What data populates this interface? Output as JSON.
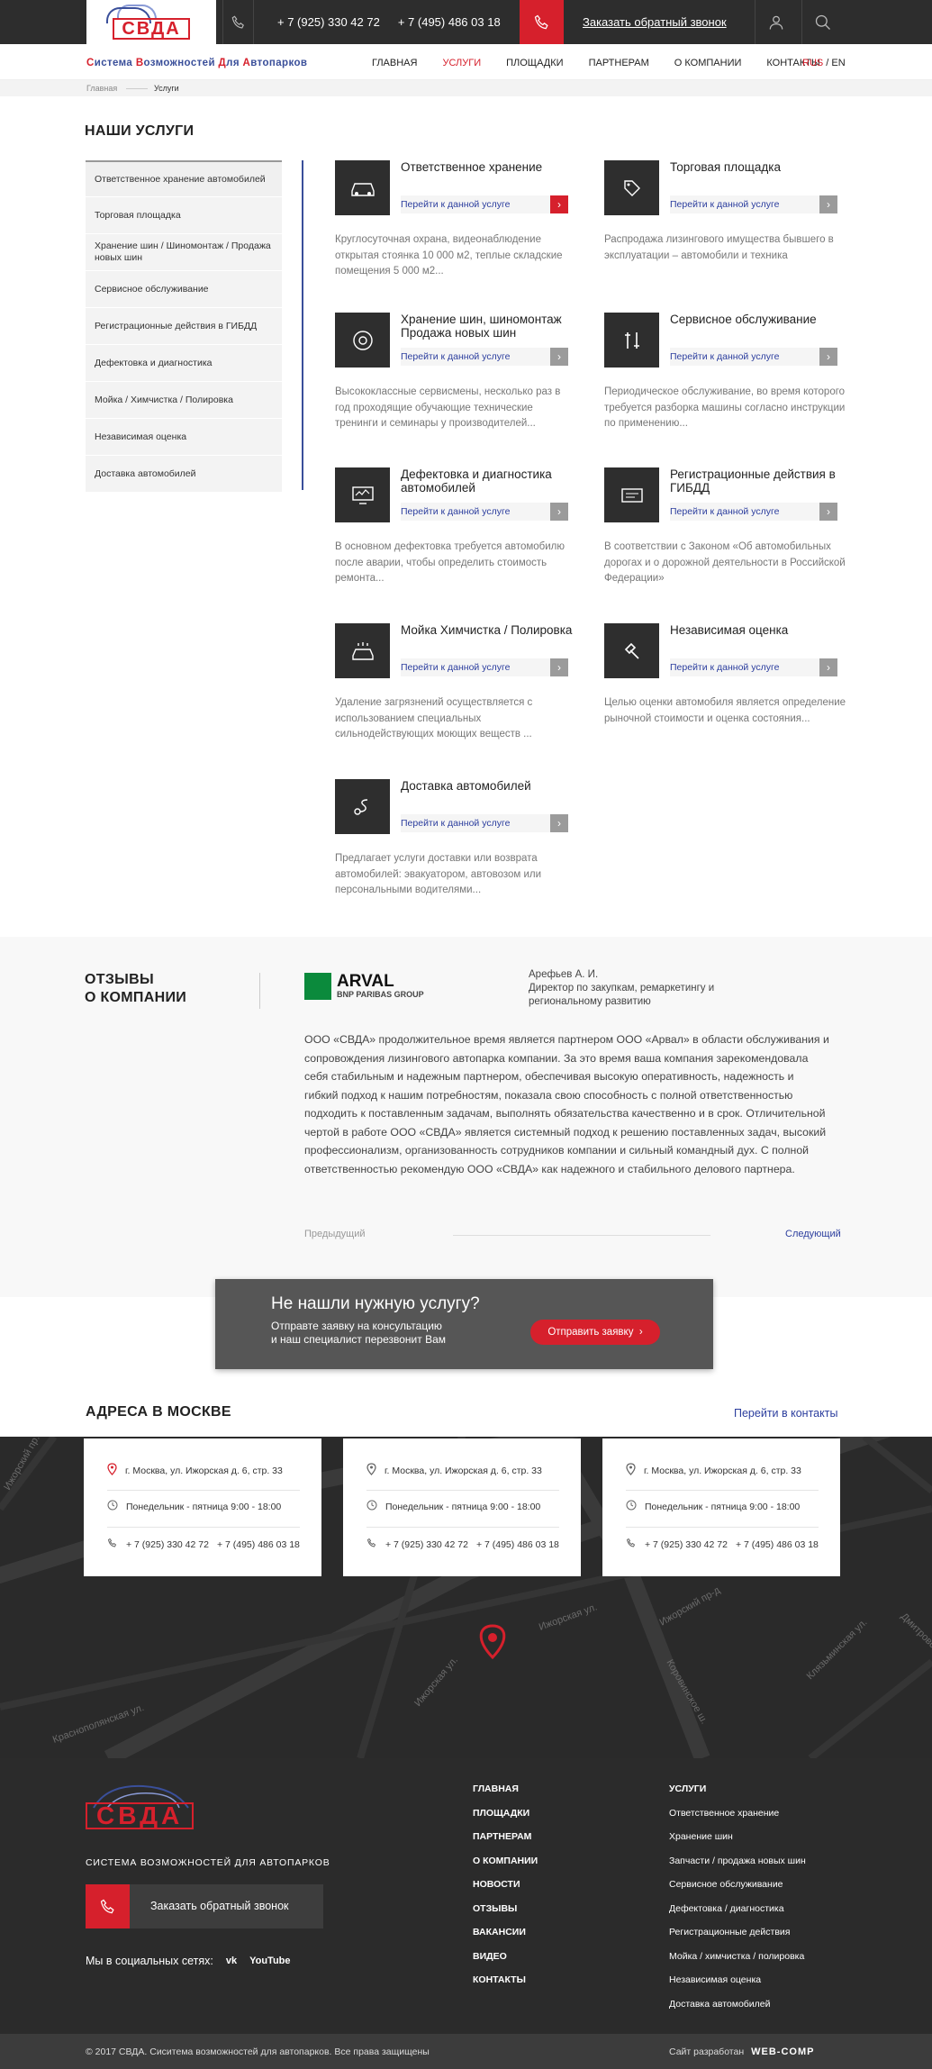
{
  "header": {
    "logo_text": "СВДА",
    "phone1": "+ 7 (925) 330 42 72",
    "phone2": "+ 7 (495) 486 03 18",
    "callback": "Заказать обратный звонок"
  },
  "nav": {
    "tagline_parts": [
      "С",
      "истема ",
      "В",
      "озможностей ",
      "Д",
      "ля ",
      "А",
      "втопарков"
    ],
    "items": [
      "ГЛАВНАЯ",
      "УСЛУГИ",
      "ПЛОЩАДКИ",
      "ПАРТНЕРАМ",
      "О КОМПАНИИ",
      "КОНТАКТЫ"
    ],
    "lang_ru": "RUS",
    "lang_sep": " / ",
    "lang_en": "EN"
  },
  "breadcrumbs": {
    "home": "Главная",
    "current": "Услуги"
  },
  "page_title": "НАШИ УСЛУГИ",
  "sidebar": [
    "Ответственное хранение автомобилей",
    "Торговая площадка",
    "Хранение шин / Шиномонтаж / Продажа новых шин",
    "Сервисное обслуживание",
    "Регистрационные действия в ГИБДД",
    "Дефектовка и диагностика",
    "Мойка / Химчистка / Полировка",
    "Независимая оценка",
    "Доставка автомобилей"
  ],
  "services": [
    {
      "title": "Ответственное хранение",
      "link": "Перейти к данной услуге",
      "icon": "car-icon",
      "desc": "Круглосуточная охрана, видеонаблюдение открытая стоянка 10 000 м2, теплые складские помещения 5 000 м2..."
    },
    {
      "title": "Торговая площадка",
      "link": "Перейти к данной услуге",
      "icon": "price-tag-icon",
      "desc": "Распродажа лизингового имущества бывшего в эксплуатации – автомобили и техника"
    },
    {
      "title": "Хранение шин, шиномонтаж Продажа новых шин",
      "link": "Перейти к данной услуге",
      "icon": "tire-icon",
      "desc": "Высококлассные сервисмены, несколько раз в год проходящие обучающие технические тренинги и семинары у производителей..."
    },
    {
      "title": "Сервисное обслуживание",
      "link": "Перейти к данной услуге",
      "icon": "tools-icon",
      "desc": "Периодическое обслуживание, во время которого требуется разборка машины согласно инструкции по применению..."
    },
    {
      "title": "Дефектовка и диагностика автомобилей",
      "link": "Перейти к данной услуге",
      "icon": "diagnostics-icon",
      "desc": "В основном дефектовка требуется автомобилю после аварии, чтобы определить стоимость ремонта..."
    },
    {
      "title": "Регистрационные действия в ГИБДД",
      "link": "Перейти к данной услуге",
      "icon": "registration-icon",
      "desc": "В соответствии с Законом «Об автомобильных дорогах и о дорожной деятельности в Российской Федерации»"
    },
    {
      "title": "Мойка Химчистка / Полировка",
      "link": "Перейти к данной услуге",
      "icon": "car-wash-icon",
      "desc": "Удаление загрязнений осуществляется с использованием специальных сильнодействующих моющих веществ ..."
    },
    {
      "title": "Независимая оценка",
      "link": "Перейти к данной услуге",
      "icon": "gavel-icon",
      "desc": " Целью оценки автомобиля является определение рыночной стоимости и оценка состояния..."
    },
    {
      "title": "Доставка автомобилей",
      "link": "Перейти к данной услуге",
      "icon": "delivery-route-icon",
      "desc": "Предлагает услуги доставки или возврата автомобилей: эвакуатором, автовозом или персональными водителями..."
    }
  ],
  "reviews": {
    "title_line1": "ОТЗЫВЫ",
    "title_line2": "О КОМПАНИИ",
    "company": "ARVAL",
    "company_sub": "BNP PARIBAS GROUP",
    "author": "Арефьев А. И.",
    "author_role": "Директор по закупкам, ремаркетингу и региональному развитию",
    "text": "ООО «СВДА» продолжительное время является партнером ООО «Арвал» в области обслуживания и сопровождения лизингового автопарка компании. За это время ваша компания зарекомендовала себя стабильным и надежным партнером, обеспечивая высокую оперативность, надежность и гибкий подход к нашим потребностям, показала свою способность с полной ответственностью подходить к поставленным задачам, выполнять  обязательства качественно и в срок. Отличительной чертой в работе ООО «СВДА» является системный подход к решению поставленных задач, высокий профессионализм, организованность сотрудников компании и сильный командный дух. С полной ответственностью рекомендую ООО «СВДА» как надежного и стабильного делового партнера.",
    "prev": "Предыдущий",
    "next": "Следующий"
  },
  "cta": {
    "heading": "Не нашли нужную услугу?",
    "line1": "Отправте заявку на консультацию",
    "line2": "и наш специалист перезвонит Вам",
    "button": "Отправить заявку"
  },
  "addresses": {
    "title": "АДРЕСА В МОСКВЕ",
    "link": "Перейти в контакты",
    "cards": [
      {
        "address": "г. Москва, ул. Ижорская д. 6, стр. 33",
        "hours": "Понедельник - пятница  9:00 - 18:00",
        "phone1": "+ 7 (925) 330 42 72",
        "phone2": "+ 7 (495) 486 03 18"
      },
      {
        "address": "г. Москва, ул. Ижорская д. 6, стр. 33",
        "hours": "Понедельник - пятница  9:00 - 18:00",
        "phone1": "+ 7 (925) 330 42 72",
        "phone2": "+ 7 (495) 486 03 18"
      },
      {
        "address": "г. Москва, ул. Ижорская д. 6, стр. 33",
        "hours": "Понедельник - пятница  9:00 - 18:00",
        "phone1": "+ 7 (925) 330 42 72",
        "phone2": "+ 7 (495) 486 03 18"
      }
    ],
    "map_labels": [
      "Ижорская ул.",
      "Ижорский пр-д",
      "Коровинское ш.",
      "Клязьминская ул.",
      "Дмитровское ш.",
      "Краснополянская ул.",
      "Ижорский пр.",
      "Ижорская ул."
    ]
  },
  "footer": {
    "logo_text": "СВДА",
    "tagline": "СИСТЕМА ВОЗМОЖНОСТЕЙ ДЛЯ АВТОПАРКОВ",
    "callback": "Заказать обратный звонок",
    "social_label": "Мы в социальных сетях:",
    "social_vk": "vk",
    "social_youtube": "YouTube",
    "col1": [
      "ГЛАВНАЯ",
      "ПЛОЩАДКИ",
      "ПАРТНЕРАМ",
      "О КОМПАНИИ",
      "НОВОСТИ",
      "ОТЗЫВЫ",
      "ВАКАНСИИ",
      "ВИДЕО",
      "КОНТАКТЫ"
    ],
    "col2_head": "УСЛУГИ",
    "col2": [
      "Ответственное хранение",
      "Хранение шин",
      "Запчасти / продажа новых шин",
      "Сервисное обслуживание",
      "Дефектовка / диагностика",
      "Регистрационные действия",
      "Мойка / химчистка / полировка",
      "Независимая оценка",
      "Доставка автомобилей"
    ],
    "copyright": "© 2017 СВДА. Сиситема возможностей для автопарков. Все права защищены",
    "dev_label": "Сайт разработан",
    "dev_name": "WEB-COMP"
  },
  "colors": {
    "accent_red": "#d6202c",
    "brand_blue": "#3a4f9a",
    "link_blue": "#2c3e9e",
    "dark": "#2d2d2d"
  }
}
